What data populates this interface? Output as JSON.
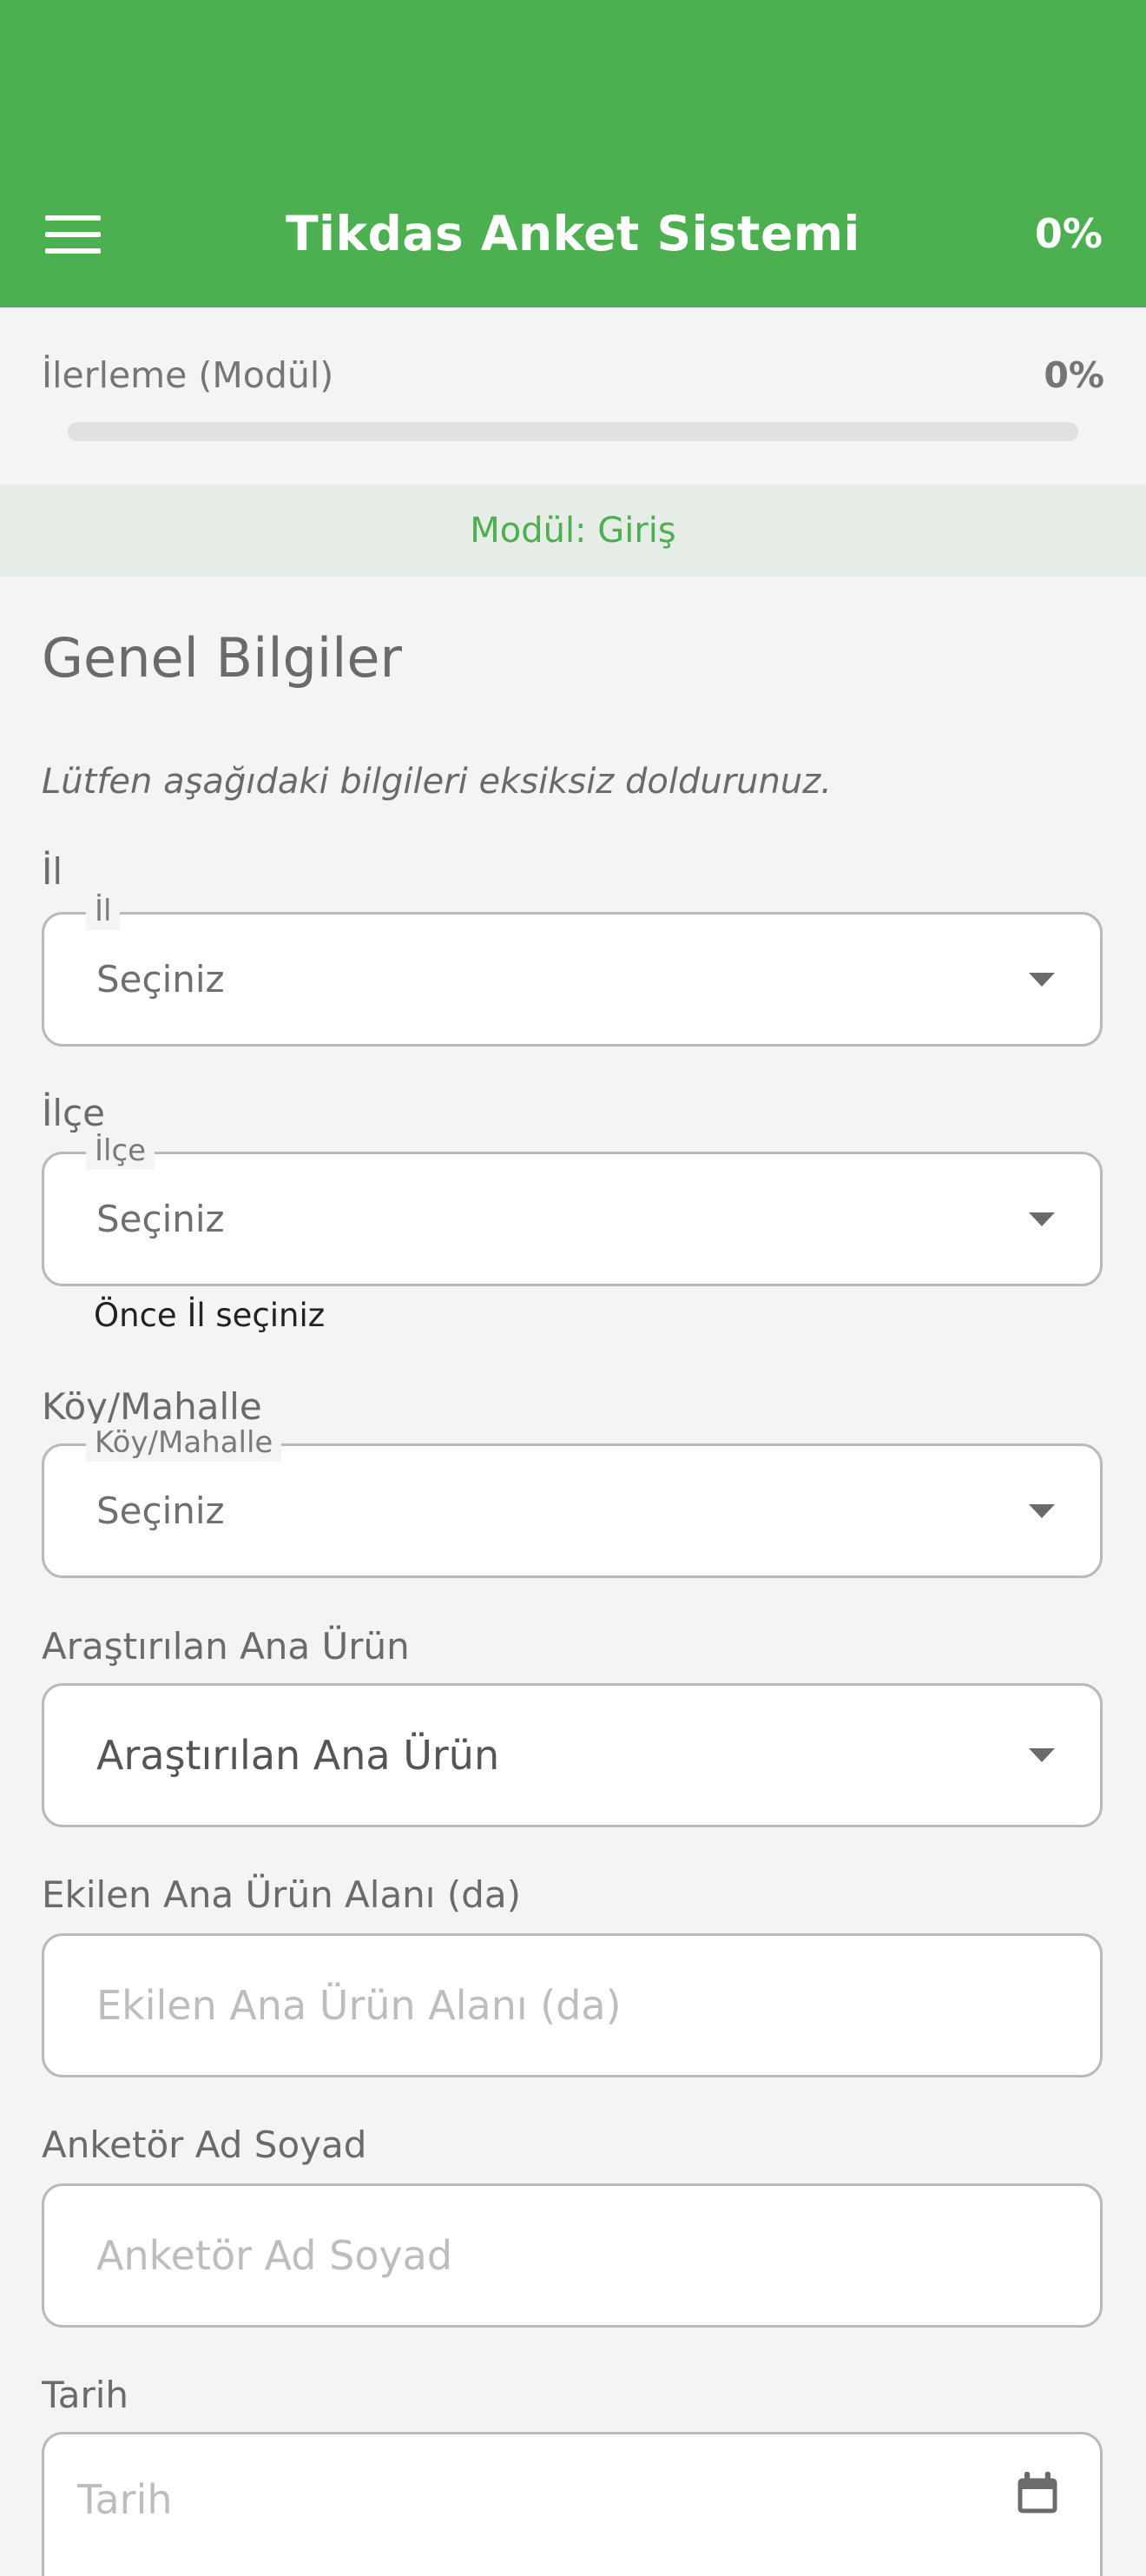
{
  "header": {
    "title": "Tikdas Anket Sistemi",
    "percent": "0%",
    "menu_icon": "hamburger-menu-icon",
    "background": "#4caf50"
  },
  "progress": {
    "label": "İlerleme (Modül)",
    "value": "0%",
    "fraction": 0
  },
  "module": {
    "label": "Modül: Giriş"
  },
  "section": {
    "title": "Genel Bilgiler",
    "instructions": "Lütfen aşağıdaki bilgileri eksiksiz doldurunuz."
  },
  "fields": {
    "il": {
      "label": "İl",
      "legend": "İl",
      "value": "Seçiniz"
    },
    "ilce": {
      "label": "İlçe",
      "legend": "İlçe",
      "value": "Seçiniz",
      "helper": "Önce İl seçiniz"
    },
    "koy": {
      "label": "Köy/Mahalle",
      "legend": "Köy/Mahalle",
      "value": "Seçiniz"
    },
    "urun": {
      "label": "Araştırılan Ana Ürün",
      "value": "Araştırılan Ana Ürün"
    },
    "alan": {
      "label": "Ekilen Ana Ürün Alanı (da)",
      "placeholder": "Ekilen Ana Ürün Alanı (da)"
    },
    "anketor": {
      "label": "Anketör Ad Soyad",
      "placeholder": "Anketör Ad Soyad"
    },
    "tarih": {
      "label": "Tarih",
      "placeholder": "Tarih",
      "icon": "calendar-icon"
    }
  }
}
